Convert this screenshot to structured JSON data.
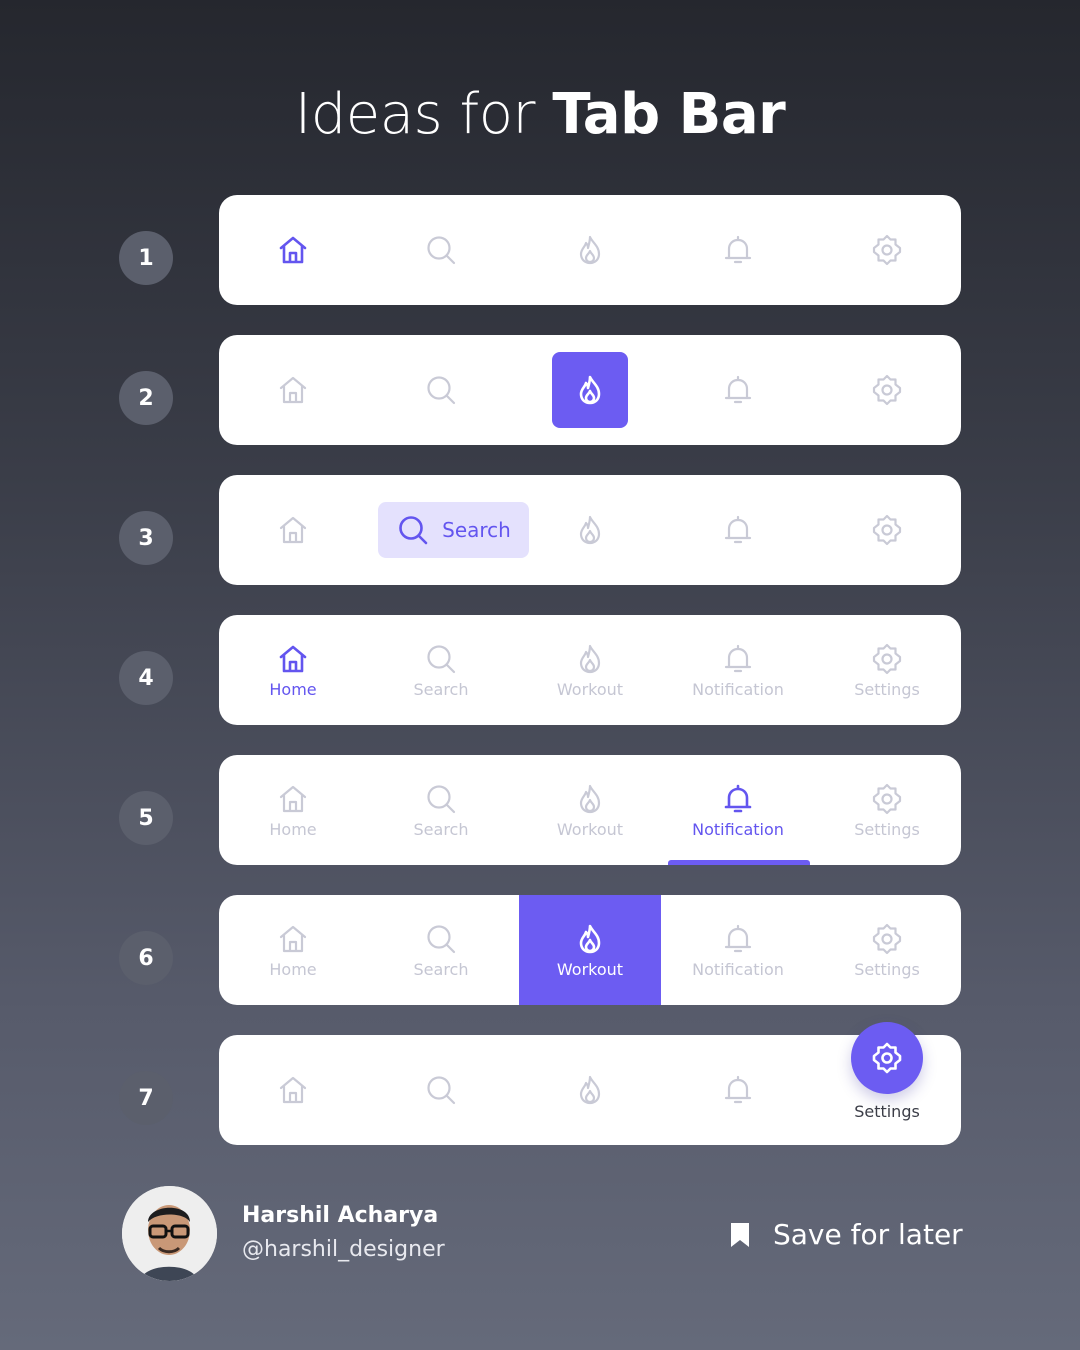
{
  "title": {
    "light": "Ideas for",
    "bold": "Tab Bar"
  },
  "accent_color": "#6c5cf2",
  "inactive_color": "#c9cad6",
  "rows": [
    {
      "number": "1"
    },
    {
      "number": "2"
    },
    {
      "number": "3",
      "active_label": "Search"
    },
    {
      "number": "4",
      "labels": [
        "Home",
        "Search",
        "Workout",
        "Notification",
        "Settings"
      ]
    },
    {
      "number": "5",
      "labels": [
        "Home",
        "Search",
        "Workout",
        "Notification",
        "Settings"
      ]
    },
    {
      "number": "6",
      "labels": [
        "Home",
        "Search",
        "Workout",
        "Notification",
        "Settings"
      ]
    },
    {
      "number": "7",
      "active_label": "Settings"
    }
  ],
  "icons": [
    "home-icon",
    "search-icon",
    "flame-icon",
    "bell-icon",
    "gear-icon"
  ],
  "author": {
    "name": "Harshil Acharya",
    "handle": "@harshil_designer"
  },
  "save": {
    "label": "Save for later",
    "icon": "bookmark-icon"
  }
}
